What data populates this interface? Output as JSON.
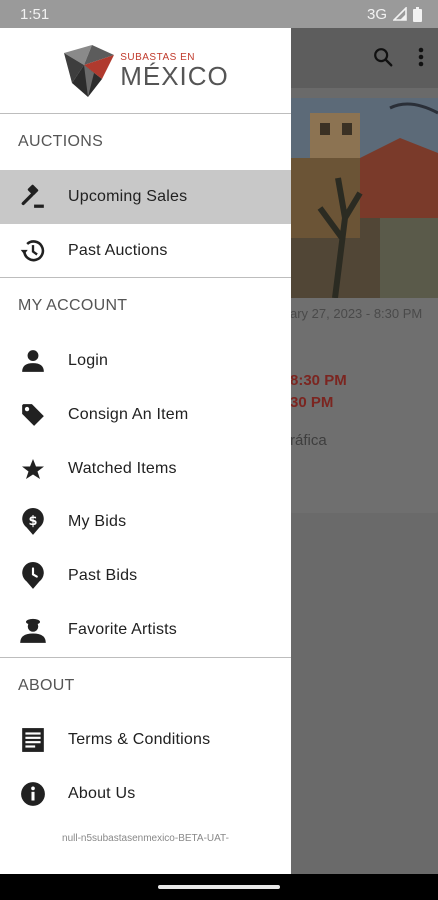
{
  "status_bar": {
    "time": "1:51",
    "network": "3G"
  },
  "logo": {
    "top_text": "SUBASTAS EN",
    "main_text": "MÉXICO"
  },
  "sections": {
    "auctions": {
      "title": "AUCTIONS",
      "items": [
        {
          "label": "Upcoming Sales",
          "icon": "gavel-icon"
        },
        {
          "label": "Past Auctions",
          "icon": "history-icon"
        }
      ]
    },
    "account": {
      "title": "MY ACCOUNT",
      "items": [
        {
          "label": "Login",
          "icon": "person-icon"
        },
        {
          "label": "Consign An Item",
          "icon": "tag-icon"
        },
        {
          "label": "Watched Items",
          "icon": "star-icon"
        },
        {
          "label": "My Bids",
          "icon": "dollar-pin-icon"
        },
        {
          "label": "Past Bids",
          "icon": "clock-pin-icon"
        },
        {
          "label": "Favorite Artists",
          "icon": "artist-icon"
        }
      ]
    },
    "about": {
      "title": "ABOUT",
      "items": [
        {
          "label": "Terms & Conditions",
          "icon": "document-icon"
        },
        {
          "label": "About Us",
          "icon": "info-icon"
        }
      ]
    }
  },
  "version": "null-n5subastasenmexico-BETA-UAT-",
  "background": {
    "date_fragment": "ary 27, 2023 - 8:30 PM",
    "time_red_1": "8:30 PM",
    "time_red_2": "30 PM",
    "subtitle_fragment": "ráfica"
  }
}
